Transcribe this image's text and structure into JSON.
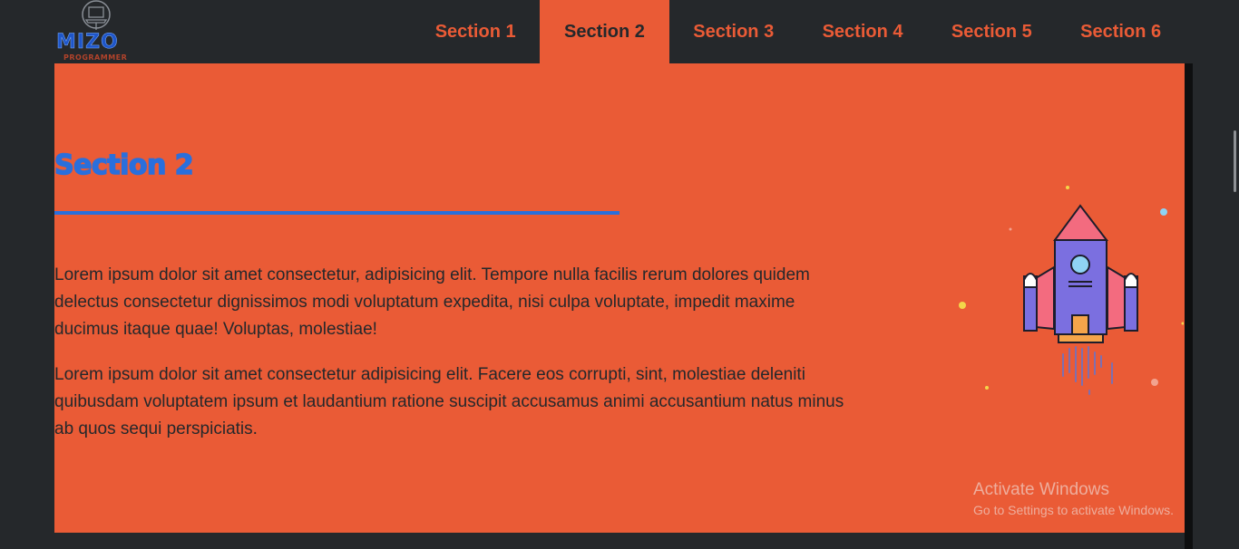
{
  "logo": {
    "name": "MIZO",
    "tagline": "PROGRAMMER"
  },
  "nav": {
    "items": [
      {
        "label": "Section 1",
        "active": false
      },
      {
        "label": "Section 2",
        "active": true
      },
      {
        "label": "Section 3",
        "active": false
      },
      {
        "label": "Section 4",
        "active": false
      },
      {
        "label": "Section 5",
        "active": false
      },
      {
        "label": "Section 6",
        "active": false
      }
    ]
  },
  "section": {
    "title": "Section 2",
    "paragraphs": [
      "Lorem ipsum dolor sit amet consectetur, adipisicing elit. Tempore nulla facilis rerum dolores quidem delectus consectetur dignissimos modi voluptatum expedita, nisi culpa voluptate, impedit maxime ducimus itaque quae! Voluptas, molestiae!",
      "Lorem ipsum dolor sit amet consectetur adipisicing elit. Facere eos corrupti, sint, molestiae deleniti quibusdam voluptatem ipsum et laudantium ratione suscipit accusamus animi accusantium natus minus ab quos sequi perspiciatis."
    ],
    "illustration_icon": "rocket-icon"
  },
  "watermark": {
    "title": "Activate Windows",
    "subtitle": "Go to Settings to activate Windows."
  },
  "colors": {
    "accent": "#ea5b36",
    "dark": "#25282b",
    "title_blue": "#2a6fdc"
  }
}
